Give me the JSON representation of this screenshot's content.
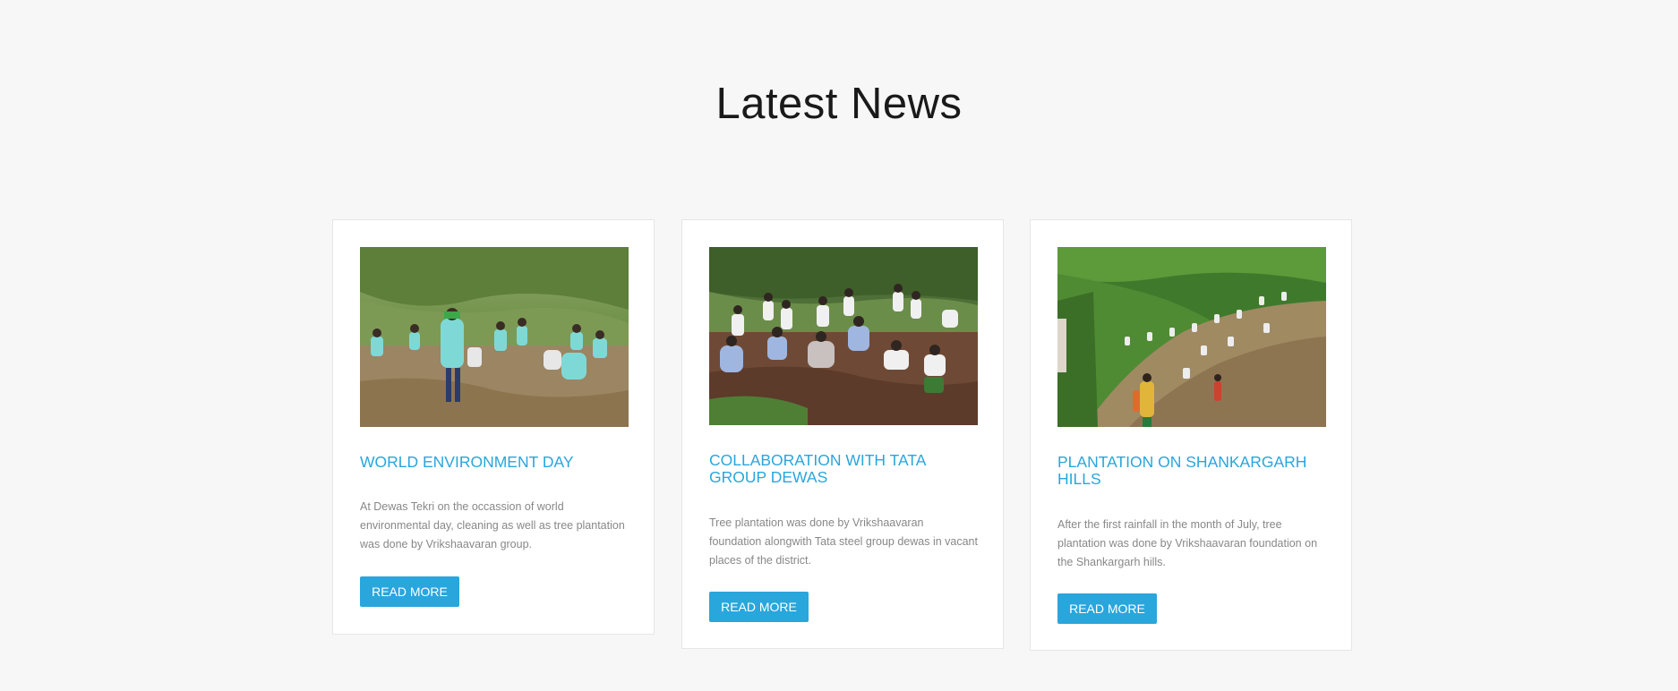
{
  "section": {
    "title": "Latest News"
  },
  "news": [
    {
      "title": "WORLD ENVIRONMENT DAY",
      "text": "At Dewas Tekri on the occassion of world environmental day, cleaning as well as tree plantation was done by Vrikshaavaran group.",
      "button_label": "READ MORE",
      "image": "photo of volunteers planting trees on a green hillside"
    },
    {
      "title": "COLLABORATION WITH TATA GROUP DEWAS",
      "text": "Tree plantation was done by Vrikshaavaran foundation alongwith Tata steel group dewas in vacant places of the district.",
      "button_label": "READ MORE",
      "image": "photo of people planting saplings in brown soil"
    },
    {
      "title": "PLANTATION ON SHANKARGARH HILLS",
      "text": "After the first rainfall in the month of July, tree plantation was done by Vrikshaavaran foundation on the Shankargarh hills.",
      "button_label": "READ MORE",
      "image": "photo of people planting on a steep forested slope"
    }
  ],
  "colors": {
    "background": "#f7f7f7",
    "accent": "#29a6dc",
    "card": "#ffffff",
    "body_text": "#888888",
    "heading": "#1a1a1a"
  }
}
